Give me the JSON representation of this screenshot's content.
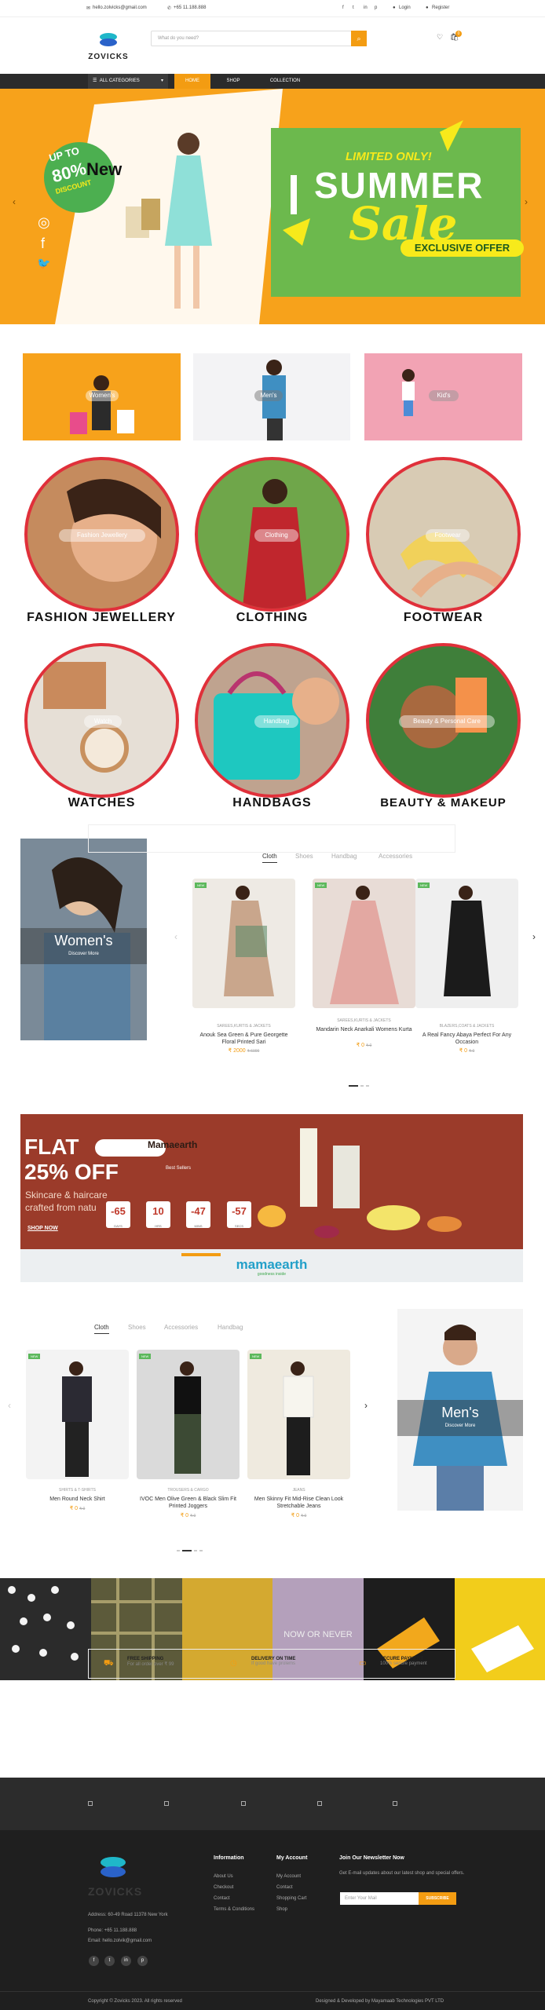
{
  "topbar": {
    "email": "hello.zolvicks@gmail.com",
    "phone": "+65 11.188.888",
    "login": "Login",
    "register": "Register"
  },
  "header": {
    "logo": "ZOVICKS",
    "search_placeholder": "What do you need?",
    "cart_count": "0"
  },
  "nav": {
    "all_categories": "ALL CATEGORIES",
    "items": [
      "HOME",
      "SHOP",
      "COLLECTION"
    ]
  },
  "hero": {
    "up_to": "UP TO",
    "percent": "80%",
    "discount": "DISCOUNT",
    "new": "New",
    "limited": "LIMITED ONLY!",
    "summer": "SUMMER",
    "sale": "Sale",
    "exclusive": "EXCLUSIVE OFFER"
  },
  "banners": [
    "Women's",
    "Men's",
    "Kid's"
  ],
  "categories": [
    {
      "pill": "Fashion Jewellery",
      "label": "FASHION JEWELLERY"
    },
    {
      "pill": "Clothing",
      "label": "CLOTHING"
    },
    {
      "pill": "Footwear",
      "label": "FOOTWEAR"
    },
    {
      "pill": "Watch",
      "label": "WATCHES"
    },
    {
      "pill": "Handbag",
      "label": "HANDBAGS"
    },
    {
      "pill": "Beauty & Personal Care",
      "label": "BEAUTY & MAKEUP"
    }
  ],
  "women_section": {
    "title": "Women's",
    "cta": "Discover More",
    "tabs": [
      "Cloth",
      "Shoes",
      "Handbag",
      "Accessories"
    ],
    "products": [
      {
        "badge": "NEW",
        "category": "SAREES,KURTIS & JACKETS",
        "name": "Anouk Sea Green & Pure Georgette Floral Printed Sari",
        "price": "₹ 2000",
        "old": "₹ 6000"
      },
      {
        "badge": "NEW",
        "category": "SAREES,KURTIS & JACKETS",
        "name": "Mandarin Neck Anarkali Womens Kurta",
        "price": "₹ 0",
        "old": "₹ 0"
      },
      {
        "badge": "NEW",
        "category": "BLAZERS,COATS & JACKETS",
        "name": "A Real Fancy Abaya Perfect For Any Occasion",
        "price": "₹ 0",
        "old": "₹ 0"
      }
    ]
  },
  "promo": {
    "flat": "FLAT",
    "off": "25% OFF",
    "brand": "Mamaearth",
    "sub1": "Skincare & haircare",
    "sub2": "crafted from natu",
    "shop": "SHOP NOW",
    "best_sellers": "Best Sellers",
    "count": [
      {
        "n": "-65",
        "l": "DAYS"
      },
      {
        "n": "10",
        "l": "HRS"
      },
      {
        "n": "-47",
        "l": "MINS"
      },
      {
        "n": "-57",
        "l": "SECS"
      }
    ],
    "logo": "mamaearth",
    "tagline": "goodness inside"
  },
  "men_section": {
    "title": "Men's",
    "cta": "Discover More",
    "tabs": [
      "Cloth",
      "Shoes",
      "Accessories",
      "Handbag"
    ],
    "products": [
      {
        "badge": "NEW",
        "category": "SHIRTS & T-SHIRTS",
        "name": "Men Round Neck Shirt",
        "price": "₹ 0",
        "old": "₹ 0"
      },
      {
        "badge": "NEW",
        "category": "TROUSERS & CARGO",
        "name": "IVOC Men Olive Green & Black Slim Fit Printed Joggers",
        "price": "₹ 0",
        "old": "₹ 0"
      },
      {
        "badge": "NEW",
        "category": "JEANS",
        "name": "Men Skinny Fit Mid-Rise Clean Look Stretchable Jeans",
        "price": "₹ 0",
        "old": "₹ 0"
      }
    ]
  },
  "features": [
    {
      "title": "FREE SHIPPING",
      "text": "For all order over ₹ 99"
    },
    {
      "title": "DELIVERY ON TIME",
      "text": "If good have prolems"
    },
    {
      "title": "SECURE PAYMENT",
      "text": "100% secure payment"
    }
  ],
  "footer": {
    "logo": "ZOVICKS",
    "address": "Address: 60-49 Road 11378 New York",
    "phone": "Phone: +65 11.188.888",
    "email": "Email: hello.zolvik@gmail.com",
    "information": "Information",
    "info_links": [
      "About Us",
      "Checkout",
      "Contact",
      "Terms & Conditions"
    ],
    "account": "My Account",
    "account_links": [
      "My Account",
      "Contact",
      "Shopping Cart",
      "Shop"
    ],
    "newsletter": "Join Our Newsletter Now",
    "newsletter_text": "Get E-mail updates about our latest shop and special offers.",
    "email_placeholder": "Enter Your Mail",
    "subscribe": "SUBSCRIBE",
    "copyright": "Copyright © Zovicks 2023. All rights reserved",
    "designed": "Designed & Developed by Mayamaab Technologies PVT LTD"
  },
  "colors": {
    "accent": "#f39c12",
    "dark": "#2b2b2b",
    "red": "#e0303a",
    "green": "#5cb85c"
  }
}
